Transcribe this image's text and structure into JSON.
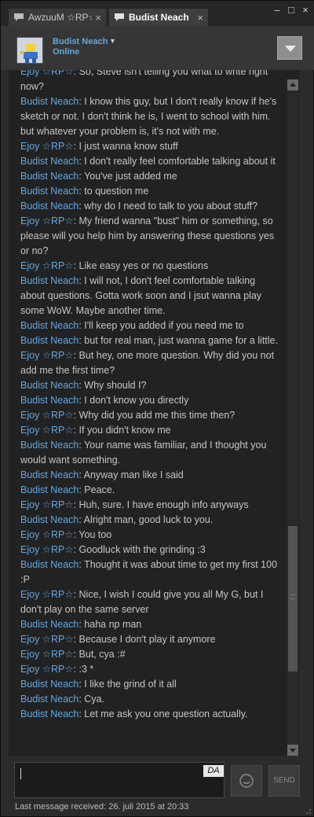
{
  "tabs": [
    {
      "label": "AwzuuM ☆RP☆",
      "close": "×"
    },
    {
      "label": "Budist Neach",
      "close": "×"
    }
  ],
  "window_controls": {
    "minimize": "–",
    "maximize": "□",
    "close": "×"
  },
  "header": {
    "friend_name": "Budist Neach",
    "dropdown": "▼",
    "status": "Online"
  },
  "messages": [
    {
      "sender": "Ejoy ☆RP☆",
      "text": ": So, Steve isn't telling you what to write right now?"
    },
    {
      "sender": "Budist Neach",
      "text": ": I know this guy, but I don't really know if he's sketch or not. I don't think he is, I went to school with him. but whatever your problem is, it's not with me."
    },
    {
      "sender": "Ejoy ☆RP☆",
      "text": ": I just wanna know stuff"
    },
    {
      "sender": "Budist Neach",
      "text": ": I don't really feel comfortable talking about it"
    },
    {
      "sender": "Budist Neach",
      "text": ": You've just added me"
    },
    {
      "sender": "Budist Neach",
      "text": ": to question me"
    },
    {
      "sender": "Budist Neach",
      "text": ": why do I need to talk to you about stuff?"
    },
    {
      "sender": "Ejoy ☆RP☆",
      "text": ": My friend wanna \"bust\" him or something, so please will you help him by answering these questions yes or no?"
    },
    {
      "sender": "Ejoy ☆RP☆",
      "text": ": Like easy yes or no questions"
    },
    {
      "sender": "Budist Neach",
      "text": ": I will not, I don't feel comfortable talking about questions. Gotta work soon and I jsut wanna play some WoW. Maybe another time."
    },
    {
      "sender": "Budist Neach",
      "text": ": I'll keep you added if you need me to"
    },
    {
      "sender": "Budist Neach",
      "text": ": but for real man, just wanna game for a little."
    },
    {
      "sender": "Ejoy ☆RP☆",
      "text": ": But hey, one more question. Why did you not add me the first time?"
    },
    {
      "sender": "Budist Neach",
      "text": ": Why should I?"
    },
    {
      "sender": "Budist Neach",
      "text": ": I don't know you directly"
    },
    {
      "sender": "Ejoy ☆RP☆",
      "text": ": Why did you add me this time then?"
    },
    {
      "sender": "Ejoy ☆RP☆",
      "text": ": If you didn't know me"
    },
    {
      "sender": "Budist Neach",
      "text": ": Your name was familiar, and I thought you would want something."
    },
    {
      "sender": "Budist Neach",
      "text": ": Anyway man like I said"
    },
    {
      "sender": "Budist Neach",
      "text": ": Peace."
    },
    {
      "sender": "Ejoy ☆RP☆",
      "text": ": Huh, sure. I have enough info anyways"
    },
    {
      "sender": "Budist Neach",
      "text": ": Alright man, good luck to you."
    },
    {
      "sender": "Ejoy ☆RP☆",
      "text": ": You too"
    },
    {
      "sender": "Ejoy ☆RP☆",
      "text": ": Goodluck with the grinding :3"
    },
    {
      "sender": "Budist Neach",
      "text": ": Thought it was about time to get my first 100 :P"
    },
    {
      "sender": "Ejoy ☆RP☆",
      "text": ": Nice, I wish I could give you all My G, but I don't play on the same server"
    },
    {
      "sender": "Budist Neach",
      "text": ": haha np man"
    },
    {
      "sender": "Ejoy ☆RP☆",
      "text": ": Because I don't play it anymore"
    },
    {
      "sender": "Ejoy ☆RP☆",
      "text": ": But, cya :#"
    },
    {
      "sender": "Ejoy ☆RP☆",
      "text": ": :3 *"
    },
    {
      "sender": "Budist Neach",
      "text": ": I like the grind of it all"
    },
    {
      "sender": "Budist Neach",
      "text": ": Cya."
    },
    {
      "sender": "Budist Neach",
      "text": ": Let me ask you one question actually."
    }
  ],
  "input": {
    "lang_badge": "DA",
    "send_label": "SEND"
  },
  "footer": {
    "last_received": "Last message received: 26. juli 2015 at 20:33"
  },
  "colors": {
    "sender_name": "#62a7e3",
    "message_text": "#c6c6c6",
    "background": "#2b2b2b"
  }
}
